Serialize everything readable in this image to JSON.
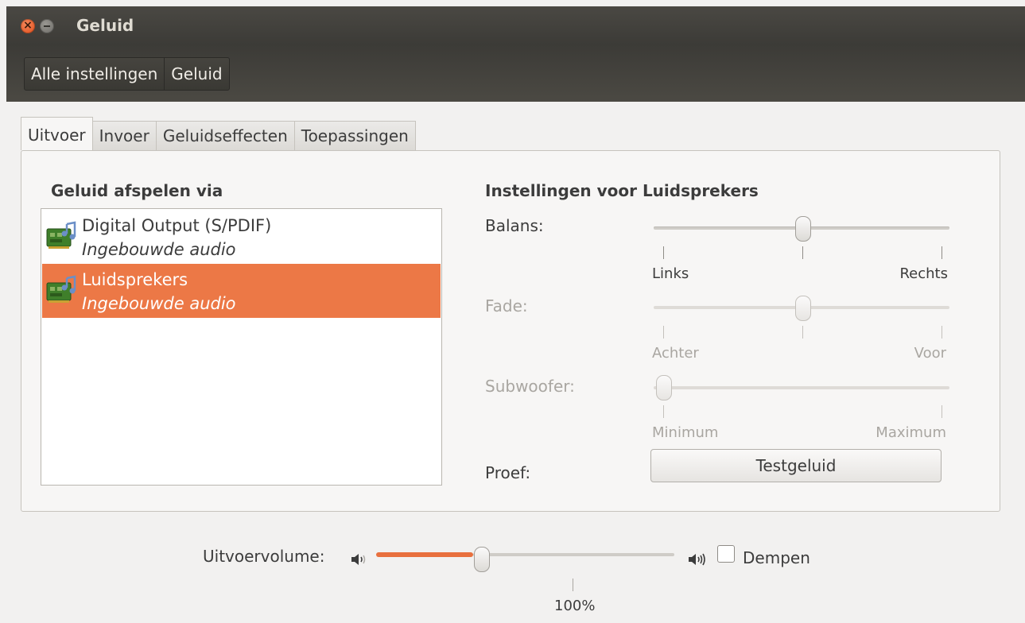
{
  "window": {
    "title": "Geluid"
  },
  "toolbar": {
    "crumbs": [
      "Alle instellingen",
      "Geluid"
    ]
  },
  "tabs": [
    "Uitvoer",
    "Invoer",
    "Geluidseffecten",
    "Toepassingen"
  ],
  "output": {
    "devices_heading": "Geluid afspelen via",
    "devices": [
      {
        "name": "Digital Output (S/PDIF)",
        "subtitle": "Ingebouwde audio",
        "icon": "sound-card-icon",
        "selected": false
      },
      {
        "name": "Luidsprekers",
        "subtitle": "Ingebouwde audio",
        "icon": "sound-card-icon",
        "selected": true
      }
    ],
    "settings_heading": "Instellingen voor Luidsprekers",
    "balance": {
      "label": "Balans:",
      "min_label": "Links",
      "max_label": "Rechts",
      "value": 0.5
    },
    "fade": {
      "label": "Fade:",
      "min_label": "Achter",
      "max_label": "Voor",
      "value": 0.5
    },
    "subwoofer": {
      "label": "Subwoofer:",
      "min_label": "Minimum",
      "max_label": "Maximum",
      "value": 0
    },
    "test": {
      "label": "Proef:",
      "button_label": "Testgeluid"
    }
  },
  "volume": {
    "label": "Uitvoervolume:",
    "value_label": "100%",
    "level": 0.33,
    "mute_label": "Dempen",
    "muted": false
  },
  "colors": {
    "accent": "#ec7846",
    "titlebar": "#3c3b37",
    "window_bg": "#f2f1f0"
  }
}
